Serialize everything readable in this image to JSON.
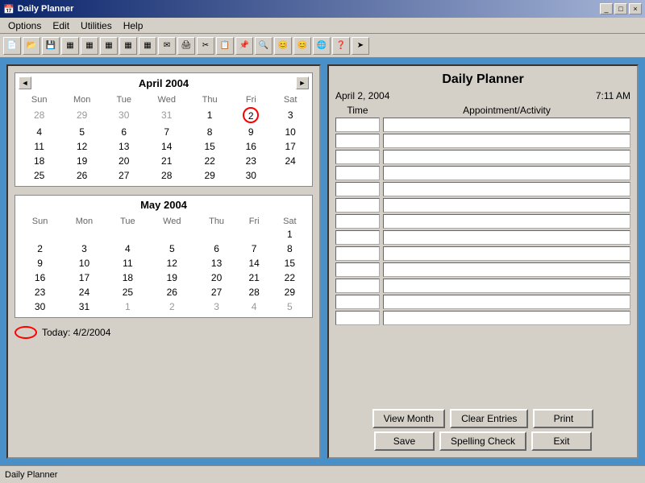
{
  "titleBar": {
    "title": "Daily Planner",
    "icon": "📅",
    "buttons": [
      "_",
      "□",
      "×"
    ]
  },
  "menuBar": {
    "items": [
      "Options",
      "Edit",
      "Utilities",
      "Help"
    ]
  },
  "planner": {
    "title": "Daily Planner",
    "date": "April 2, 2004",
    "time": "7:11 AM",
    "timeHeader": "Time",
    "apptHeader": "Appointment/Activity",
    "rowCount": 13
  },
  "april2004": {
    "title": "April 2004",
    "dayHeaders": [
      "Sun",
      "Mon",
      "Tue",
      "Wed",
      "Thu",
      "Fri",
      "Sat"
    ],
    "weeks": [
      [
        "28",
        "29",
        "30",
        "31",
        "1",
        "2",
        "3"
      ],
      [
        "4",
        "5",
        "6",
        "7",
        "8",
        "9",
        "10"
      ],
      [
        "11",
        "12",
        "13",
        "14",
        "15",
        "16",
        "17"
      ],
      [
        "18",
        "19",
        "20",
        "21",
        "22",
        "23",
        "24"
      ],
      [
        "25",
        "26",
        "27",
        "28",
        "29",
        "30",
        ""
      ]
    ],
    "currentMonthStart": 5,
    "todayCell": "2",
    "todayRow": 0,
    "todayCol": 5
  },
  "may2004": {
    "title": "May 2004",
    "dayHeaders": [
      "Sun",
      "Mon",
      "Tue",
      "Wed",
      "Thu",
      "Fri",
      "Sat"
    ],
    "weeks": [
      [
        "",
        "",
        "",
        "",
        "",
        "",
        "1"
      ],
      [
        "2",
        "3",
        "4",
        "5",
        "6",
        "7",
        "8"
      ],
      [
        "9",
        "10",
        "11",
        "12",
        "13",
        "14",
        "15"
      ],
      [
        "16",
        "17",
        "18",
        "19",
        "20",
        "21",
        "22"
      ],
      [
        "23",
        "24",
        "25",
        "26",
        "27",
        "28",
        "29"
      ],
      [
        "30",
        "31",
        "1",
        "2",
        "3",
        "4",
        "5"
      ]
    ]
  },
  "today": {
    "label": "Today: 4/2/2004"
  },
  "buttons": {
    "viewMonth": "View Month",
    "clearEntries": "Clear Entries",
    "print": "Print",
    "save": "Save",
    "spellingCheck": "Spelling Check",
    "exit": "Exit"
  },
  "statusBar": {
    "text": "Daily Planner"
  }
}
